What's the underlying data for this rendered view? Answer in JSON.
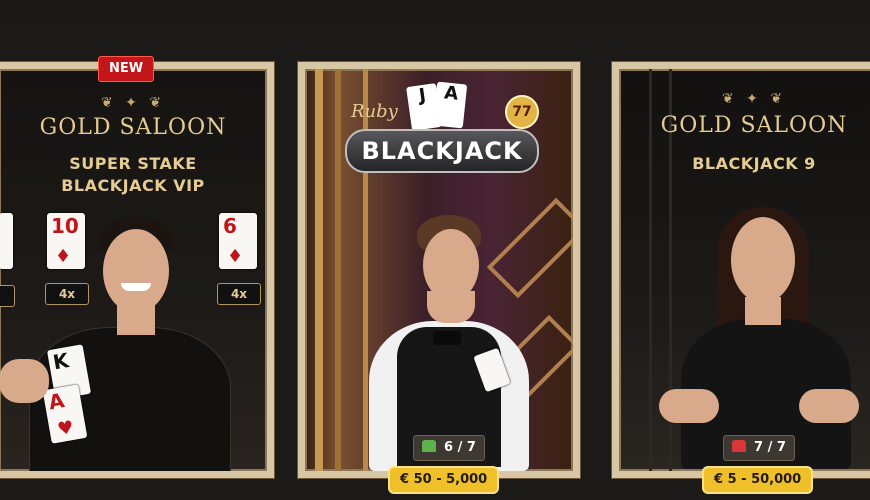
{
  "tables": [
    {
      "badge": "NEW",
      "ornament": "❦ ✦ ❦",
      "brand": "GOLD SALOON",
      "subtitle_line1": "SUPER STAKE",
      "subtitle_line2": "BLACKJACK VIP",
      "cards": [
        {
          "rank": "10",
          "suit": "♦",
          "multiplier": "4x"
        },
        {
          "rank": "6",
          "suit": "♦",
          "multiplier": "4x"
        }
      ],
      "dealer_cards": [
        "K",
        "A"
      ]
    },
    {
      "logo_script": "Ruby",
      "logo": "BLACKJACK",
      "logo_badge": "77",
      "logo_cards": [
        "J",
        "A"
      ],
      "seats": "6 / 7",
      "seat_color": "#5fb14b",
      "limit": "€ 50 - 5,000"
    },
    {
      "ornament": "❦ ✦ ❦",
      "brand": "GOLD SALOON",
      "subtitle": "BLACKJACK 9",
      "seats": "7 / 7",
      "seat_color": "#d9363a",
      "limit": "€ 5 - 50,000"
    }
  ]
}
